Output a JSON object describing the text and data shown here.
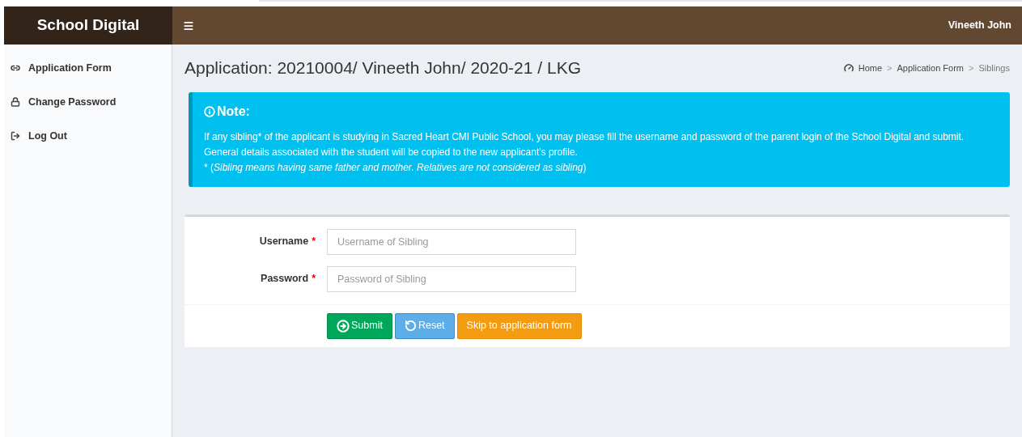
{
  "brand": "School Digital",
  "user": "Vineeth John",
  "sidebar": {
    "items": [
      {
        "kind": "link",
        "label": "Application Form"
      },
      {
        "kind": "lock",
        "label": "Change Password"
      },
      {
        "kind": "logout",
        "label": "Log Out"
      }
    ]
  },
  "page_title": "Application: 20210004/ Vineeth John/ 2020-21 / LKG",
  "breadcrumb": [
    {
      "label": "Home",
      "current": false
    },
    {
      "label": "Application Form",
      "current": false
    },
    {
      "label": "Siblings",
      "current": true
    }
  ],
  "breadcrumb_separator": ">",
  "note": {
    "title": "Note:",
    "lines": [
      "If any sibling* of the applicant is studying in Sacred Heart CMI Public School, you may please fill the username and password of the parent login of the School Digital and submit.",
      "General details associated with the student will be copied to the new applicant's profile."
    ],
    "footnote_mark": "*",
    "footnote": "(*Sibling means having same father and mother. Relatives are not considered as sibling*)"
  },
  "fields": [
    {
      "label": "Username",
      "required": true,
      "placeholder": "Username of Sibling"
    },
    {
      "label": "Password",
      "required": true,
      "placeholder": "Password of Sibling"
    }
  ],
  "required_mark": "*",
  "buttons": [
    {
      "kind": "submit",
      "label": "Submit"
    },
    {
      "kind": "reset",
      "label": "Reset"
    },
    {
      "kind": "skip",
      "label": "Skip to application form"
    }
  ]
}
